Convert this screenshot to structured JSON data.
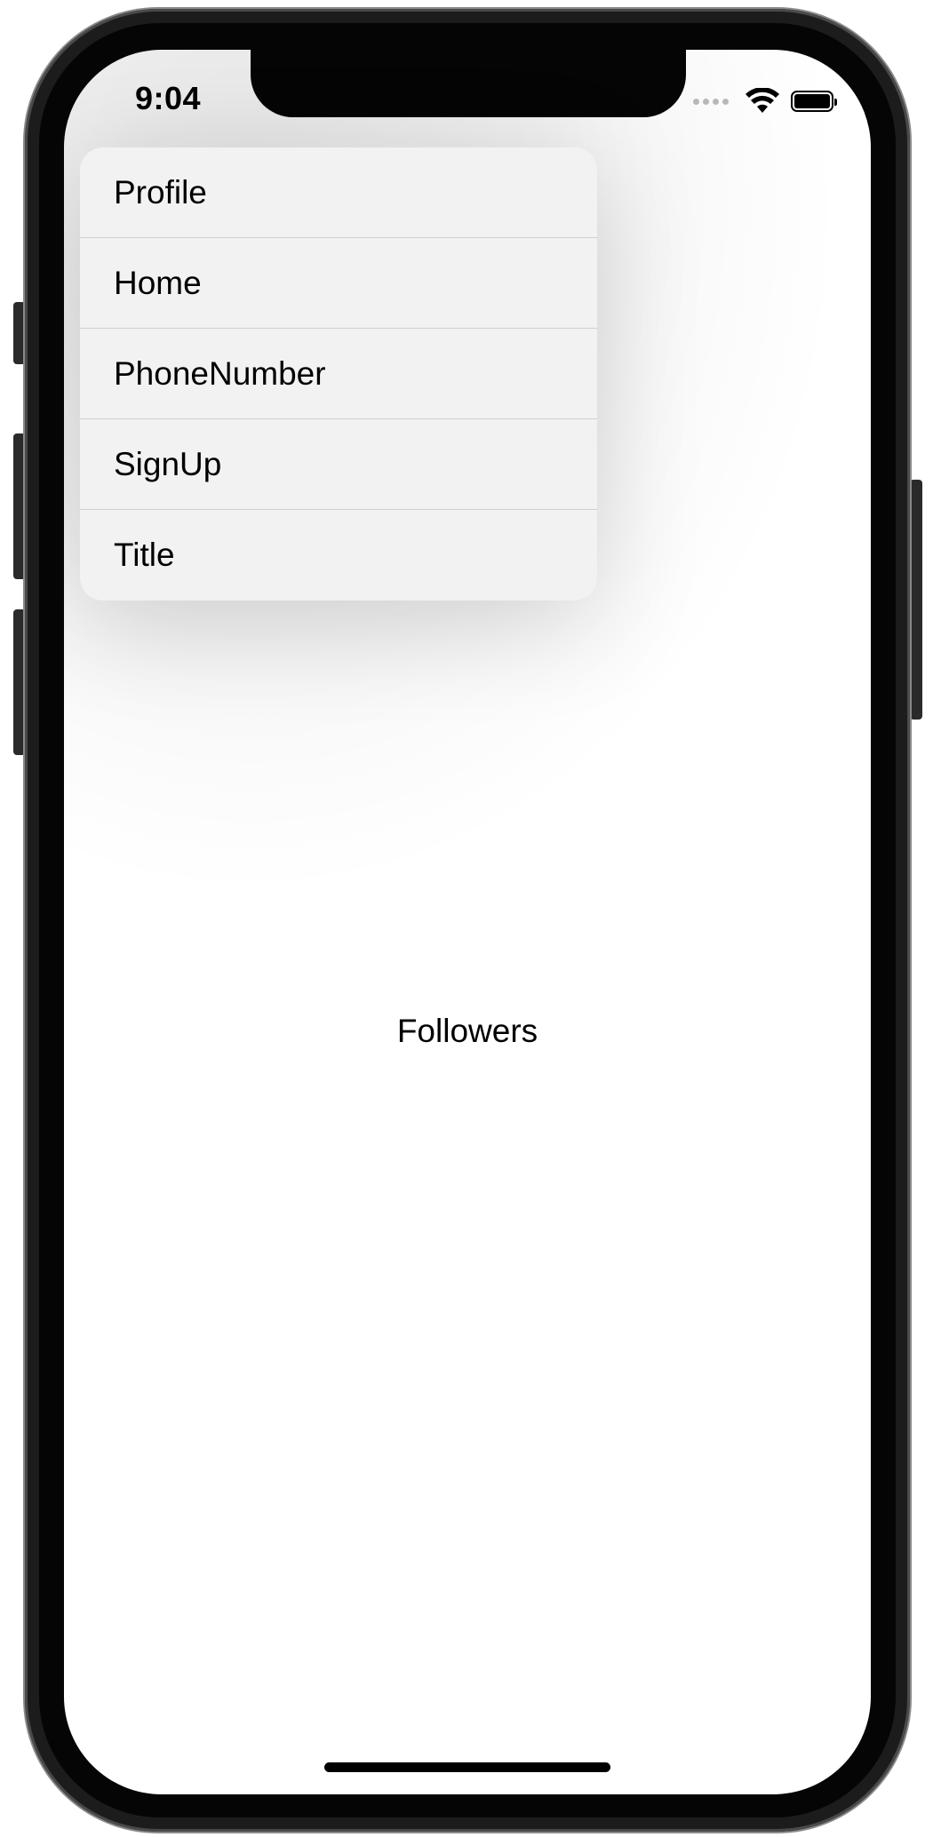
{
  "status_bar": {
    "time": "9:04",
    "icons": [
      "cellular-signal-icon",
      "wifi-icon",
      "battery-icon"
    ]
  },
  "menu": {
    "items": [
      {
        "label": "Profile"
      },
      {
        "label": "Home"
      },
      {
        "label": "PhoneNumber"
      },
      {
        "label": "SignUp"
      },
      {
        "label": "Title"
      }
    ]
  },
  "content": {
    "label": "Followers"
  },
  "colors": {
    "menu_background": "#f2f2f3",
    "separator": "#cfcfd2",
    "text": "#000000",
    "screen_background": "#ffffff"
  }
}
